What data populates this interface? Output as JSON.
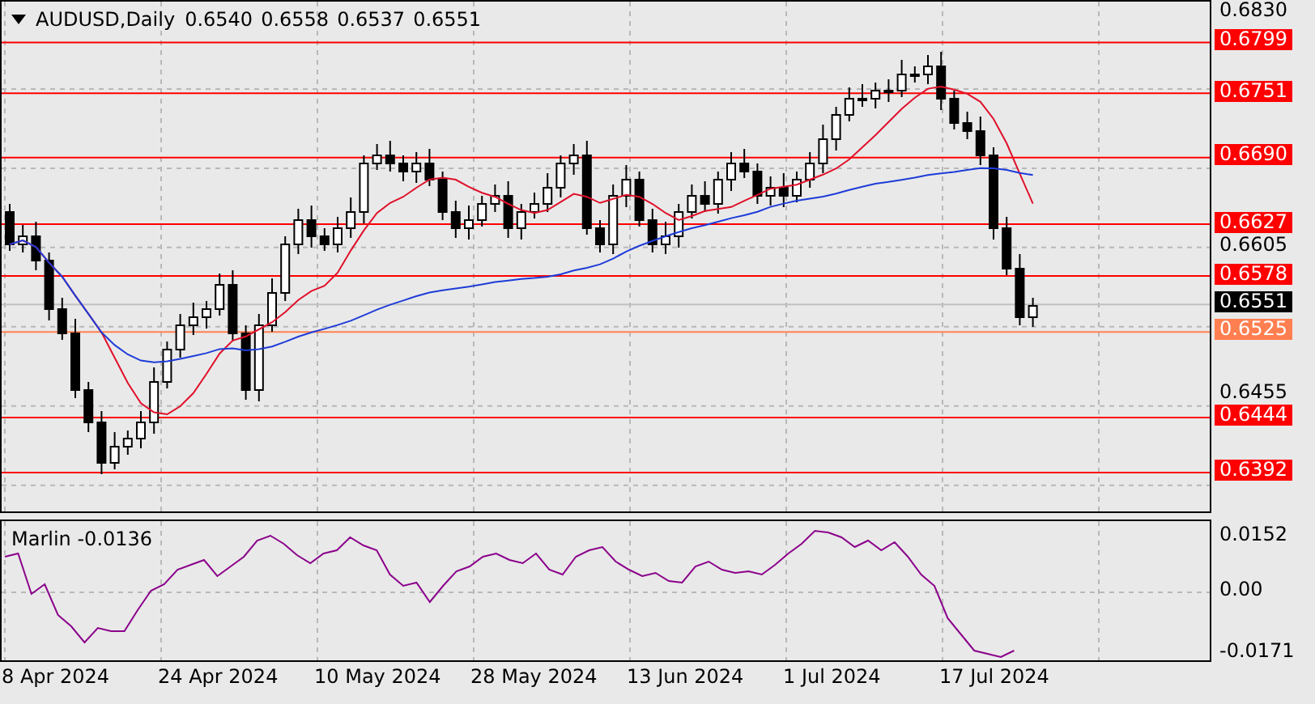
{
  "chart": {
    "symbol": "AUDUSD,Daily",
    "ohlc": [
      "0.6540",
      "0.6558",
      "0.6537",
      "0.6551"
    ],
    "price_ticks": [
      "0.6830",
      "0.6605",
      "0.6455"
    ],
    "levels": [
      {
        "label": "0.6799",
        "color": "#ff0000"
      },
      {
        "label": "0.6751",
        "color": "#ff0000"
      },
      {
        "label": "0.6690",
        "color": "#ff0000"
      },
      {
        "label": "0.6627",
        "color": "#ff0000"
      },
      {
        "label": "0.6578",
        "color": "#ff0000"
      },
      {
        "label": "0.6525",
        "color": "#ff7f50"
      },
      {
        "label": "0.6444",
        "color": "#ff0000"
      },
      {
        "label": "0.6392",
        "color": "#ff0000"
      }
    ],
    "current_price": "0.6551"
  },
  "indicator": {
    "label": "Marlin -0.0136",
    "ticks": [
      "0.0152",
      "0.00",
      "-0.0171"
    ]
  },
  "dates": [
    "8 Apr 2024",
    "24 Apr 2024",
    "10 May 2024",
    "28 May 2024",
    "13 Jun 2024",
    "1 Jul 2024",
    "17 Jul 2024"
  ]
}
